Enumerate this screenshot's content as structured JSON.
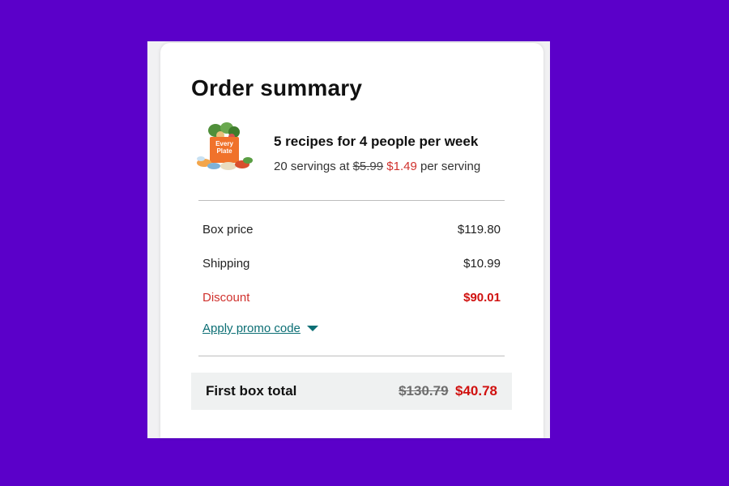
{
  "summary": {
    "title": "Order summary",
    "product_image": "everyplate-box-icon",
    "product_image_label": "Every Plate",
    "plan_title": "5 recipes for 4 people per week",
    "plan_sub_prefix": "20 servings at",
    "old_price_per_serving": "$5.99",
    "new_price_per_serving": "$1.49",
    "plan_sub_suffix": "per serving"
  },
  "rows": [
    {
      "label": "Box price",
      "value": "$119.80"
    },
    {
      "label": "Shipping",
      "value": "$10.99"
    },
    {
      "label": "Discount",
      "value": "$90.01"
    }
  ],
  "promo": {
    "label": "Apply promo code",
    "icon": "caret-down-icon"
  },
  "total": {
    "label": "First box total",
    "old_value": "$130.79",
    "new_value": "$40.78"
  },
  "colors": {
    "background": "#5b00c9",
    "discount_red": "#d0110f",
    "link_teal": "#0b6e74",
    "total_bg": "#eff1f1"
  }
}
